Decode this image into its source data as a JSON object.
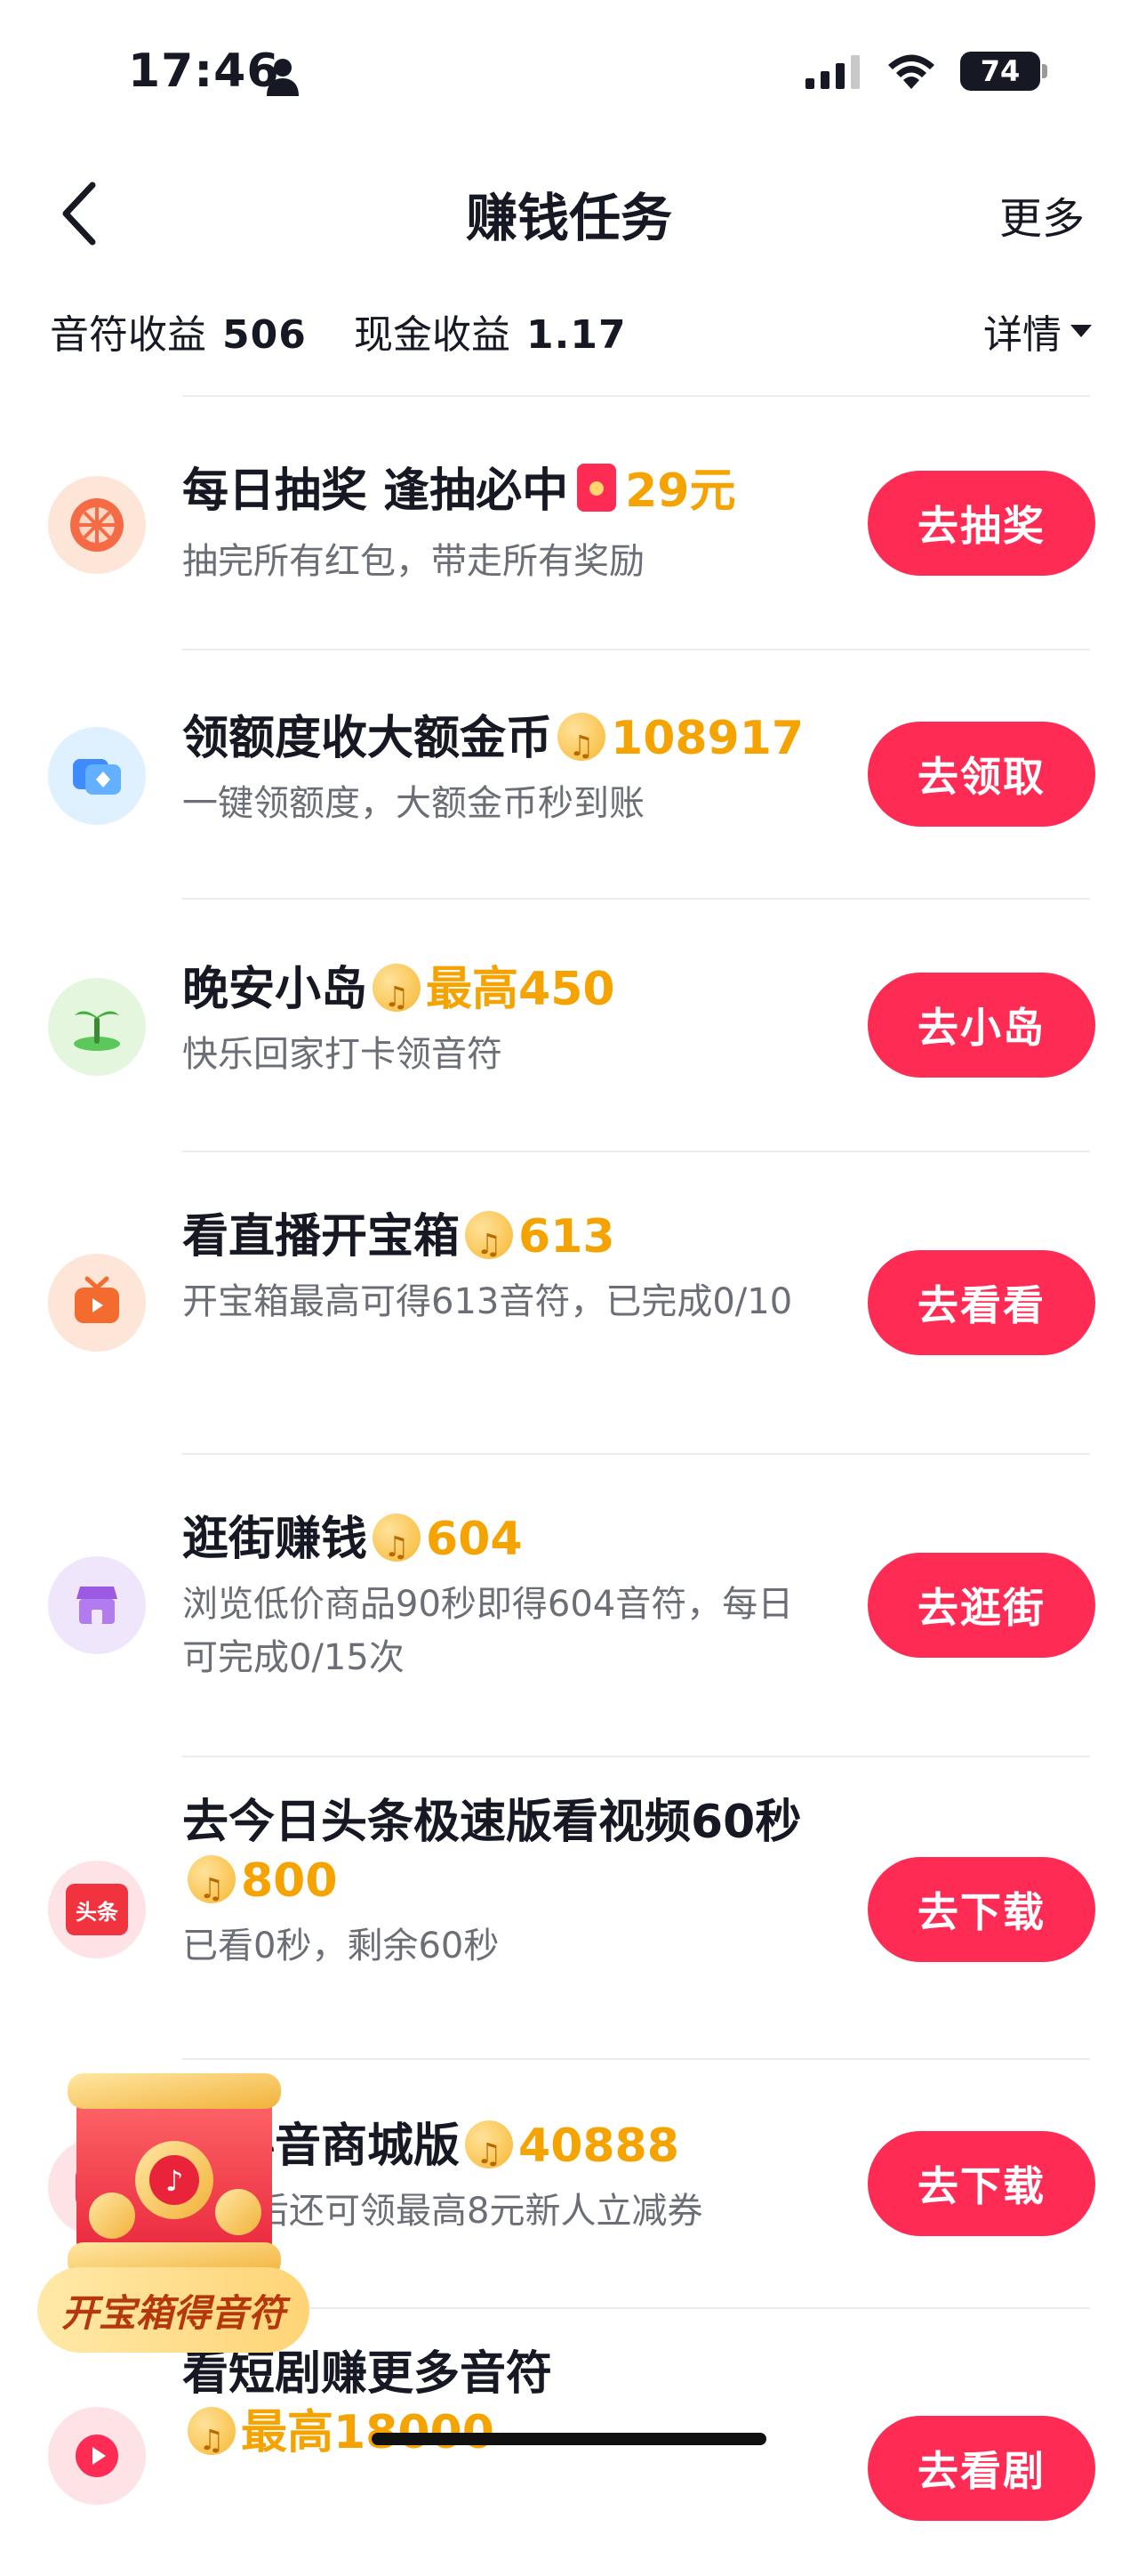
{
  "status_bar": {
    "time": "17:46",
    "battery": "74"
  },
  "nav": {
    "title": "赚钱任务",
    "more": "更多"
  },
  "earnings": {
    "notes_label": "音符收益",
    "notes_value": "506",
    "cash_label": "现金收益",
    "cash_value": "1.17",
    "detail": "详情"
  },
  "tasks": [
    {
      "title": "每日抽奖 逢抽必中",
      "reward": "29元",
      "reward_icon": "red-packet-icon",
      "desc": "抽完所有红包，带走所有奖励",
      "button": "去抽奖",
      "icon": "lottery-wheel-icon"
    },
    {
      "title": "领额度收大额金币",
      "reward": "108917",
      "reward_icon": "note-coin-icon",
      "desc": "一键领额度，大额金币秒到账",
      "button": "去领取",
      "icon": "quota-card-icon"
    },
    {
      "title": "晚安小岛",
      "reward": "最高450",
      "reward_icon": "note-coin-icon",
      "desc": "快乐回家打卡领音符",
      "button": "去小岛",
      "icon": "island-icon"
    },
    {
      "title": "看直播开宝箱",
      "reward": "613",
      "reward_icon": "note-coin-icon",
      "desc": "开宝箱最高可得613音符，已完成0/10",
      "button": "去看看",
      "icon": "live-tv-icon"
    },
    {
      "title": "逛街赚钱",
      "reward": "604",
      "reward_icon": "note-coin-icon",
      "desc": "浏览低价商品90秒即得604音符，每日可完成0/15次",
      "button": "去逛街",
      "icon": "shop-icon"
    },
    {
      "title": "去今日头条极速版看视频60秒",
      "reward": "800",
      "reward_icon": "note-coin-icon",
      "desc": "已看0秒，剩余60秒",
      "button": "去下载",
      "icon": "toutiao-icon",
      "icon_text": "头条"
    },
    {
      "title": "去抖音商城版",
      "reward": "40888",
      "reward_icon": "note-coin-icon",
      "desc": "下载后还可领最高8元新人立减券",
      "button": "去下载",
      "icon": "douyin-mall-icon"
    },
    {
      "title": "看短剧赚更多音符",
      "reward": "最高18000",
      "reward_icon": "note-coin-icon",
      "desc": "",
      "button": "去看剧",
      "icon": "short-drama-icon"
    }
  ],
  "floating": {
    "label": "开宝箱得音符"
  },
  "colors": {
    "accent": "#fe2c55",
    "reward": "#f5a300",
    "text": "#161823",
    "secondary": "#6b6e76"
  }
}
